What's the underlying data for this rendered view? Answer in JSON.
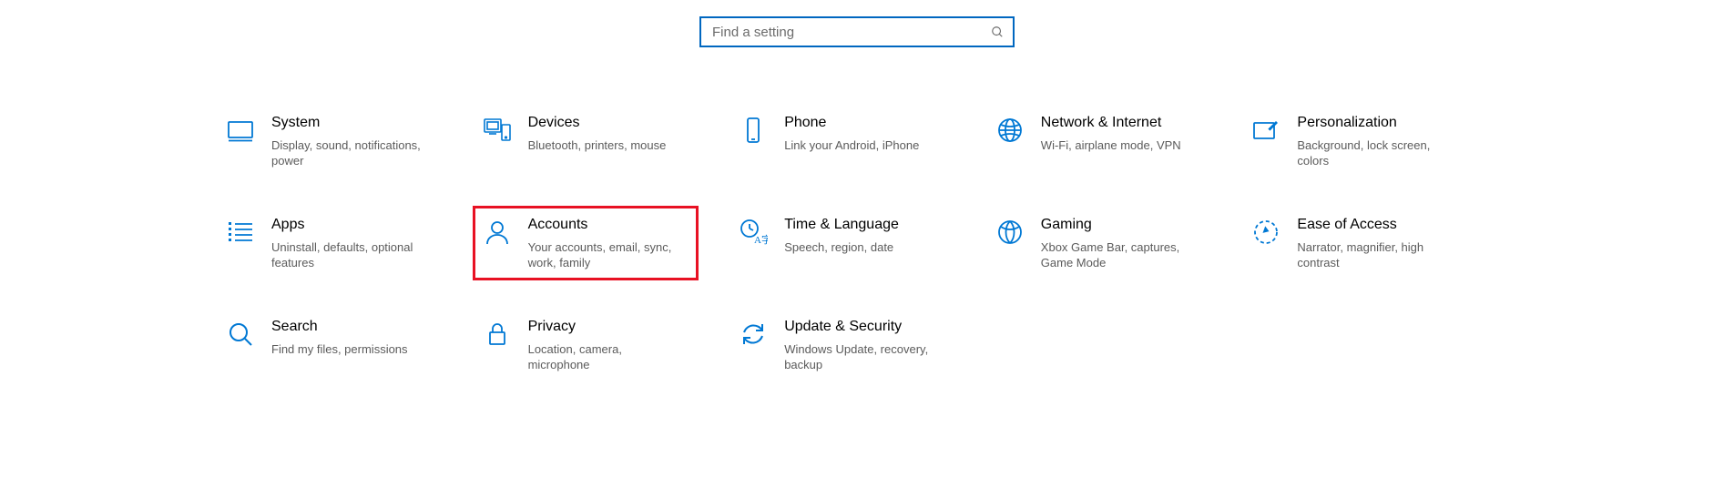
{
  "search": {
    "placeholder": "Find a setting"
  },
  "tiles": {
    "system": {
      "title": "System",
      "desc": "Display, sound, notifications, power"
    },
    "devices": {
      "title": "Devices",
      "desc": "Bluetooth, printers, mouse"
    },
    "phone": {
      "title": "Phone",
      "desc": "Link your Android, iPhone"
    },
    "network": {
      "title": "Network & Internet",
      "desc": "Wi-Fi, airplane mode, VPN"
    },
    "personalization": {
      "title": "Personalization",
      "desc": "Background, lock screen, colors"
    },
    "apps": {
      "title": "Apps",
      "desc": "Uninstall, defaults, optional features"
    },
    "accounts": {
      "title": "Accounts",
      "desc": "Your accounts, email, sync, work, family"
    },
    "time": {
      "title": "Time & Language",
      "desc": "Speech, region, date"
    },
    "gaming": {
      "title": "Gaming",
      "desc": "Xbox Game Bar, captures, Game Mode"
    },
    "ease": {
      "title": "Ease of Access",
      "desc": "Narrator, magnifier, high contrast"
    },
    "search_tile": {
      "title": "Search",
      "desc": "Find my files, permissions"
    },
    "privacy": {
      "title": "Privacy",
      "desc": "Location, camera, microphone"
    },
    "update": {
      "title": "Update & Security",
      "desc": "Windows Update, recovery, backup"
    }
  },
  "highlight": "accounts",
  "colors": {
    "accent": "#0078D4",
    "search_border": "#0067C0",
    "highlight": "#E81123",
    "desc": "#5b5b5b"
  }
}
